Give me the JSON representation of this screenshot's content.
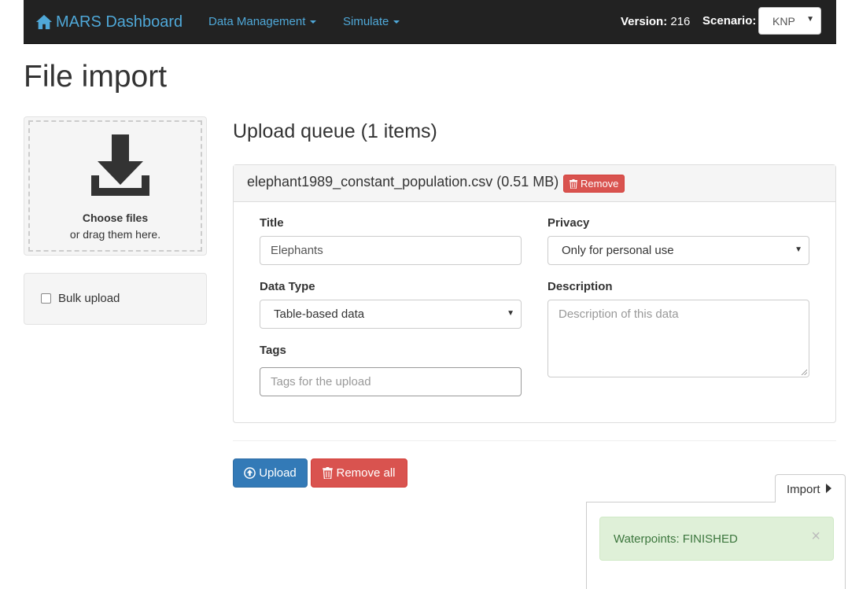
{
  "navbar": {
    "brand": "MARS Dashboard",
    "menu": [
      {
        "label": "Data Management"
      },
      {
        "label": "Simulate"
      }
    ],
    "version_label": "Version:",
    "version_value": "216",
    "scenario_label": "Scenario:",
    "scenario_value": "KNP"
  },
  "page": {
    "title": "File import"
  },
  "dropzone": {
    "choose": "Choose files",
    "hint": "or drag them here."
  },
  "bulk": {
    "label": "Bulk upload",
    "checked": false
  },
  "queue": {
    "title": "Upload queue (1 items)",
    "item": {
      "file": "elephant1989_constant_population.csv (0.51 MB)",
      "remove_label": "Remove",
      "form": {
        "title_label": "Title",
        "title_value": "Elephants",
        "privacy_label": "Privacy",
        "privacy_value": "Only for personal use",
        "datatype_label": "Data Type",
        "datatype_value": "Table-based data",
        "description_label": "Description",
        "description_placeholder": "Description of this data",
        "tags_label": "Tags",
        "tags_placeholder": "Tags for the upload"
      }
    },
    "upload_label": "Upload",
    "remove_all_label": "Remove all"
  },
  "import_panel": {
    "toggle_label": "Import",
    "alert_text": "Waterpoints: FINISHED",
    "close_glyph": "×"
  },
  "colors": {
    "navbar_bg": "#222222",
    "link": "#4fa8d8",
    "primary": "#337ab7",
    "danger": "#d9534f",
    "success_bg": "#dff0d8",
    "success_text": "#3c763d"
  }
}
